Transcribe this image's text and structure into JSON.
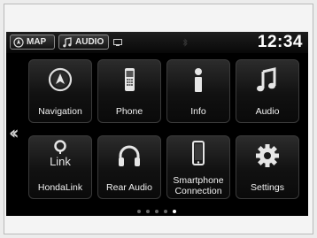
{
  "status_bar": {
    "map_label": "MAP",
    "audio_label": "AUDIO",
    "clock": "12:34"
  },
  "home": {
    "tiles": [
      {
        "label": "Navigation",
        "icon": "navigation-icon"
      },
      {
        "label": "Phone",
        "icon": "phone-icon"
      },
      {
        "label": "Info",
        "icon": "info-icon"
      },
      {
        "label": "Audio",
        "icon": "music-note-icon"
      },
      {
        "label": "HondaLink",
        "icon": "hondalink-icon",
        "icon_text": "Link"
      },
      {
        "label": "Rear Audio",
        "icon": "headphones-icon"
      },
      {
        "label_line1": "Smartphone",
        "label_line2": "Connection",
        "icon": "smartphone-icon"
      },
      {
        "label": "Settings",
        "icon": "gear-icon"
      }
    ],
    "page_count": 5,
    "active_page": 5
  },
  "colors": {
    "screen_bg": "#000000",
    "text": "#ffffff",
    "frame_bg": "#f4f4f4"
  }
}
